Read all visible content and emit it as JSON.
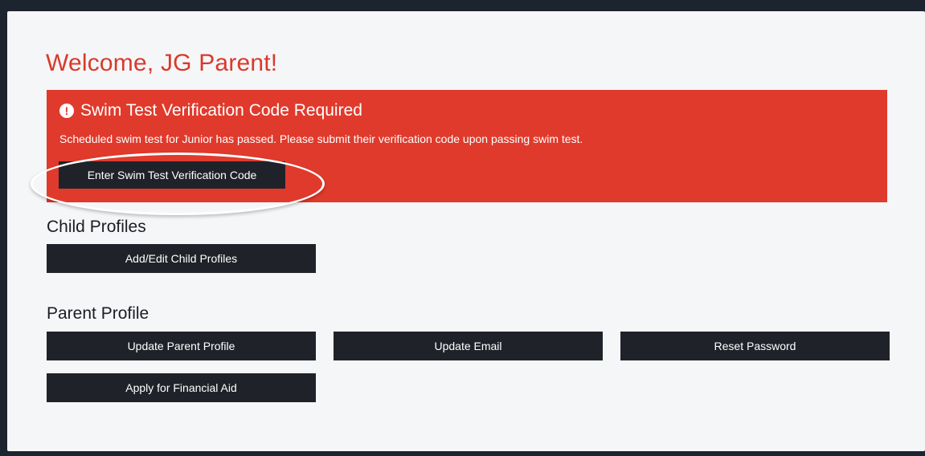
{
  "welcome": "Welcome, JG Parent!",
  "alert": {
    "title": "Swim Test Verification Code Required",
    "icon": "exclamation-circle-icon",
    "message": "Scheduled swim test for Junior has passed. Please submit their verification code upon passing swim test.",
    "button_label": "Enter Swim Test Verification Code",
    "color": "#e03a2c"
  },
  "child_profiles": {
    "title": "Child Profiles",
    "add_edit_label": "Add/Edit Child Profiles"
  },
  "parent_profile": {
    "title": "Parent Profile",
    "update_profile_label": "Update Parent Profile",
    "update_email_label": "Update Email",
    "reset_password_label": "Reset Password",
    "financial_aid_label": "Apply for Financial Aid"
  },
  "colors": {
    "accent_red": "#d93a2b",
    "button_dark": "#1f2329",
    "page_bg": "#f5f6f8"
  }
}
